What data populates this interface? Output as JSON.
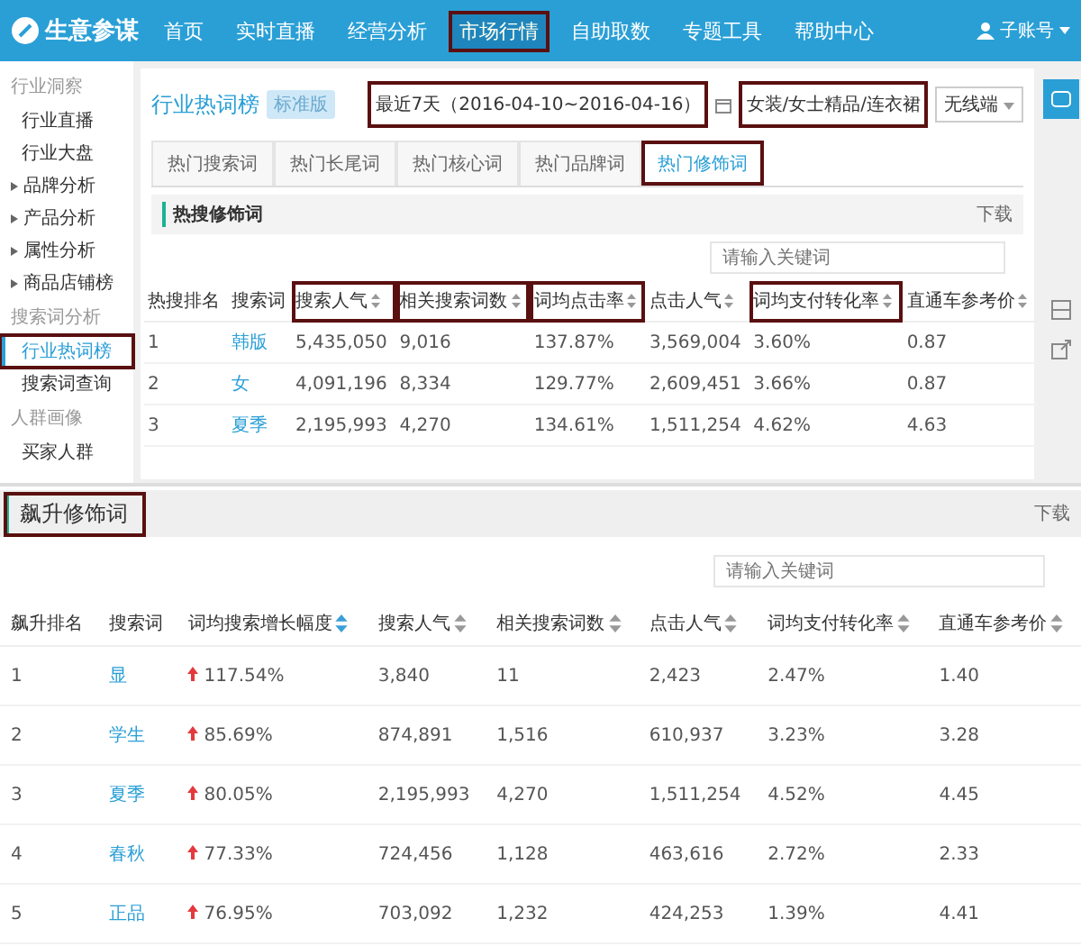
{
  "nav": {
    "logo": "生意参谋",
    "items": [
      {
        "label": "首页",
        "selected": false,
        "highlight": false
      },
      {
        "label": "实时直播",
        "selected": false,
        "highlight": false
      },
      {
        "label": "经营分析",
        "selected": false,
        "highlight": false
      },
      {
        "label": "市场行情",
        "selected": true,
        "highlight": true
      },
      {
        "label": "自助取数",
        "selected": false,
        "highlight": false
      },
      {
        "label": "专题工具",
        "selected": false,
        "highlight": false
      },
      {
        "label": "帮助中心",
        "selected": false,
        "highlight": false
      }
    ],
    "user": "子账号"
  },
  "sidebar": [
    {
      "kind": "header",
      "label": "行业洞察"
    },
    {
      "kind": "item",
      "label": "行业直播",
      "selected": false,
      "highlight": false
    },
    {
      "kind": "item",
      "label": "行业大盘",
      "selected": false,
      "highlight": false
    },
    {
      "kind": "group",
      "label": "品牌分析"
    },
    {
      "kind": "group",
      "label": "产品分析"
    },
    {
      "kind": "group",
      "label": "属性分析"
    },
    {
      "kind": "group",
      "label": "商品店铺榜"
    },
    {
      "kind": "header",
      "label": "搜索词分析"
    },
    {
      "kind": "item",
      "label": "行业热词榜",
      "selected": true,
      "highlight": true
    },
    {
      "kind": "item",
      "label": "搜索词查询",
      "selected": false,
      "highlight": false
    },
    {
      "kind": "header",
      "label": "人群画像"
    },
    {
      "kind": "item",
      "label": "买家人群",
      "selected": false,
      "highlight": false
    }
  ],
  "page": {
    "title": "行业热词榜",
    "badge": "标准版",
    "date": "最近7天（2016-04-10~2016-04-16）",
    "category": "女装/女士精品/连衣裙",
    "device": "无线端"
  },
  "tabs": [
    {
      "label": "热门搜索词",
      "selected": false
    },
    {
      "label": "热门长尾词",
      "selected": false
    },
    {
      "label": "热门核心词",
      "selected": false
    },
    {
      "label": "热门品牌词",
      "selected": false
    },
    {
      "label": "热门修饰词",
      "selected": true
    }
  ],
  "hot": {
    "title": "热搜修饰词",
    "download": "下载",
    "search": {
      "placeholder": "请输入关键词"
    },
    "columns": [
      {
        "label": "热搜排名",
        "sortable": false,
        "highlight": false
      },
      {
        "label": "搜索词",
        "sortable": false,
        "highlight": false
      },
      {
        "label": "搜索人气",
        "sortable": true,
        "highlight": true
      },
      {
        "label": "相关搜索词数",
        "sortable": true,
        "highlight": true
      },
      {
        "label": "词均点击率",
        "sortable": true,
        "highlight": true
      },
      {
        "label": "点击人气",
        "sortable": true,
        "highlight": false
      },
      {
        "label": "词均支付转化率",
        "sortable": true,
        "highlight": true
      },
      {
        "label": "直通车参考价",
        "sortable": true,
        "highlight": false
      }
    ],
    "rows": [
      [
        "1",
        "韩版",
        "5,435,050",
        "9,016",
        "137.87%",
        "3,569,004",
        "3.60%",
        "0.87"
      ],
      [
        "2",
        "女",
        "4,091,196",
        "8,334",
        "129.77%",
        "2,609,451",
        "3.66%",
        "0.87"
      ],
      [
        "3",
        "夏季",
        "2,195,993",
        "4,270",
        "134.61%",
        "1,511,254",
        "4.62%",
        "4.63"
      ]
    ]
  },
  "rising": {
    "title": "飙升修饰词",
    "highlight": true,
    "download": "下载",
    "search": {
      "placeholder": "请输入关键词"
    },
    "columns": [
      {
        "label": "飙升排名",
        "sortable": false
      },
      {
        "label": "搜索词",
        "sortable": false
      },
      {
        "label": "词均搜索增长幅度",
        "sortable": true,
        "active": true
      },
      {
        "label": "搜索人气",
        "sortable": true,
        "active": false
      },
      {
        "label": "相关搜索词数",
        "sortable": true,
        "active": false
      },
      {
        "label": "点击人气",
        "sortable": true,
        "active": false
      },
      {
        "label": "词均支付转化率",
        "sortable": true,
        "active": false
      },
      {
        "label": "直通车参考价",
        "sortable": true,
        "active": false
      }
    ],
    "rows": [
      [
        "1",
        "显",
        "117.54%",
        "3,840",
        "11",
        "2,423",
        "2.47%",
        "1.40"
      ],
      [
        "2",
        "学生",
        "85.69%",
        "874,891",
        "1,516",
        "610,937",
        "3.23%",
        "3.28"
      ],
      [
        "3",
        "夏季",
        "80.05%",
        "2,195,993",
        "4,270",
        "1,511,254",
        "4.52%",
        "4.45"
      ],
      [
        "4",
        "春秋",
        "77.33%",
        "724,456",
        "1,128",
        "463,616",
        "2.72%",
        "2.33"
      ],
      [
        "5",
        "正品",
        "76.95%",
        "703,092",
        "1,232",
        "424,253",
        "1.39%",
        "4.41"
      ]
    ]
  }
}
